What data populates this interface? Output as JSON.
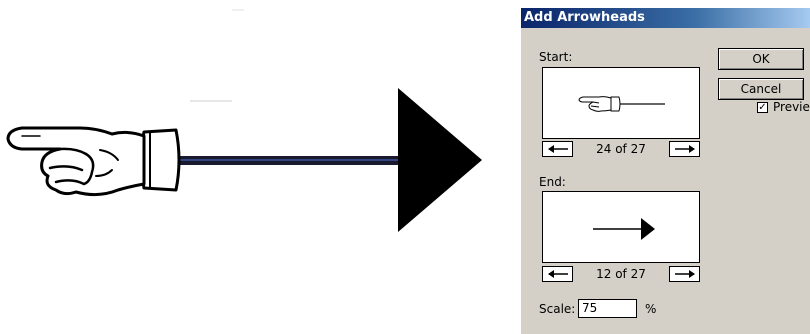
{
  "dialog": {
    "title": "Add Arrowheads",
    "start_label": "Start:",
    "start_counter": "24 of 27",
    "end_label": "End:",
    "end_counter": "12 of 27",
    "ok_label": "OK",
    "cancel_label": "Cancel",
    "preview_label": "Preview",
    "preview_checked": true,
    "scale_label": "Scale:",
    "scale_value": "75",
    "scale_unit": "%",
    "prev_icon": "left-arrow-icon",
    "next_icon": "right-arrow-icon"
  },
  "canvas": {
    "start_arrowhead": "pointing-hand-icon",
    "end_arrowhead": "triangle-arrowhead-icon",
    "stroke_color": "#1a1a2e",
    "anchor_color": "#4a6fd6"
  }
}
